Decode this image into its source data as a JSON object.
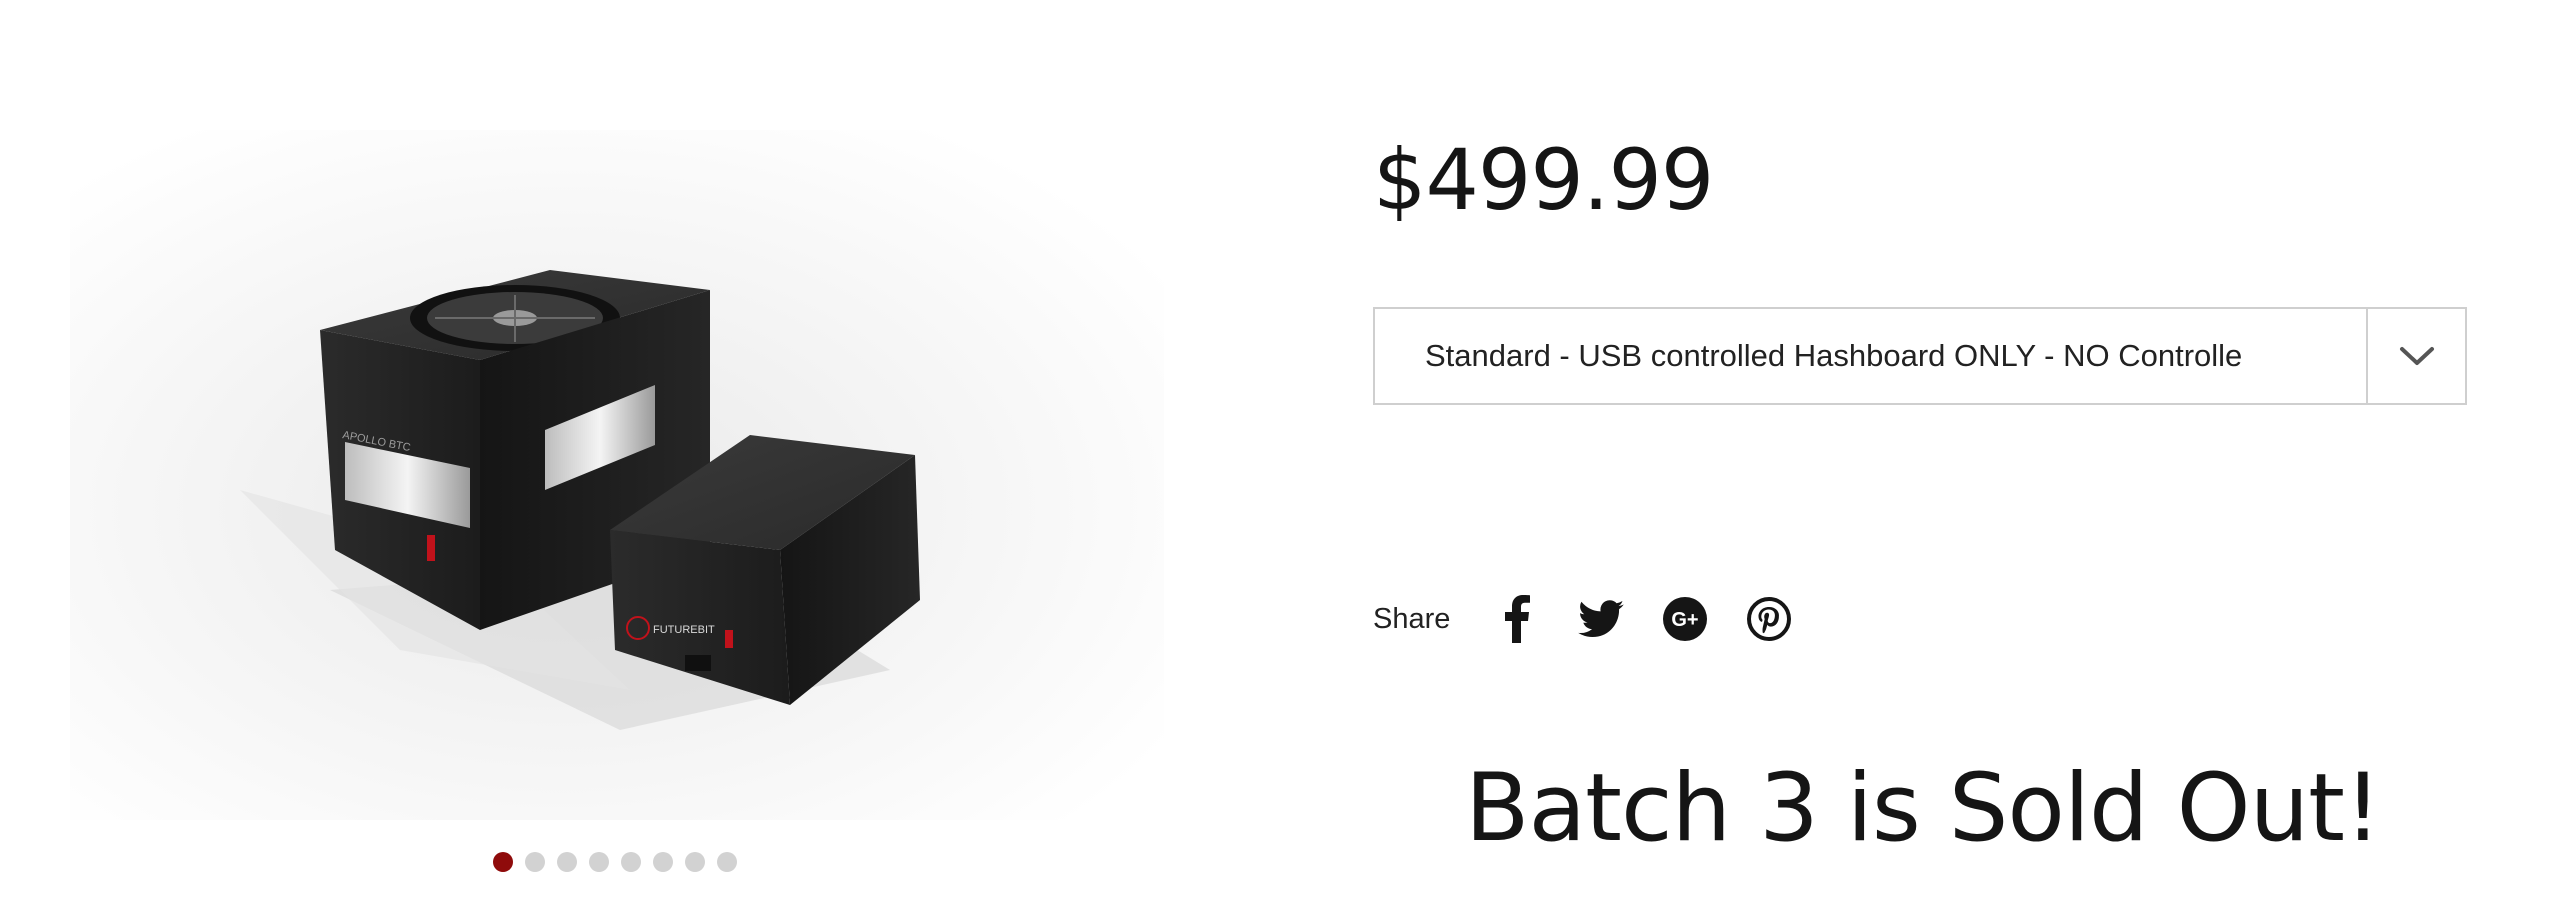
{
  "product": {
    "price": "$499.99",
    "variant_selected": "Standard - USB controlled Hashboard ONLY - NO Controlle",
    "status_message": "Batch 3 is Sold Out!",
    "image_labels": {
      "main_unit_logo": "APOLLO BTC",
      "side_unit_logo": "FUTUREBIT"
    }
  },
  "gallery": {
    "slide_count": 8,
    "active_slide": 1,
    "active_dot_color": "#8f0b0b",
    "inactive_dot_color": "#d2d2d2"
  },
  "share": {
    "label": "Share",
    "icons": [
      "facebook-icon",
      "twitter-icon",
      "google-plus-icon",
      "pinterest-icon"
    ]
  },
  "select": {
    "icon": "chevron-down-icon"
  }
}
